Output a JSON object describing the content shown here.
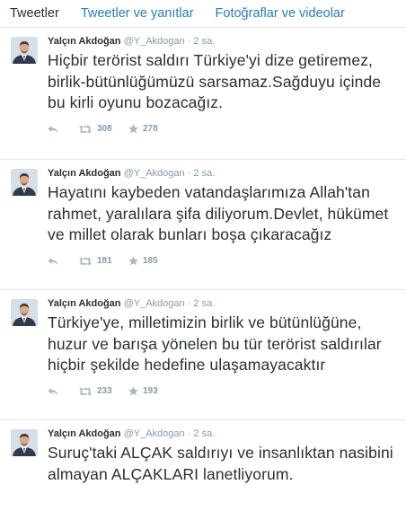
{
  "tabs": [
    {
      "label": "Tweetler"
    },
    {
      "label": "Tweetler ve yanıtlar"
    },
    {
      "label": "Fotoğraflar ve videolar"
    }
  ],
  "tweets": [
    {
      "name": "Yalçın Akdoğan",
      "handle": "@Y_Akdogan",
      "separator": "·",
      "time": "2 sa.",
      "text": "Hiçbir terörist saldırı Türkiye'yi dize getiremez, birlik-bütünlüğümüzü sarsamaz.Sağduyu içinde bu kirli oyunu bozacağız.",
      "retweets": "308",
      "favorites": "278"
    },
    {
      "name": "Yalçın Akdoğan",
      "handle": "@Y_Akdogan",
      "separator": "·",
      "time": "2 sa.",
      "text": "Hayatını kaybeden vatandaşlarımıza Allah'tan rahmet, yaralılara şifa diliyorum.Devlet, hükümet ve millet olarak bunları boşa çıkaracağız",
      "retweets": "181",
      "favorites": "185"
    },
    {
      "name": "Yalçın Akdoğan",
      "handle": "@Y_Akdogan",
      "separator": "·",
      "time": "2 sa.",
      "text": "Türkiye'ye, milletimizin birlik ve bütünlüğüne, huzur ve barışa yönelen bu tür terörist saldırılar hiçbir şekilde hedefine ulaşamayacaktır",
      "retweets": "233",
      "favorites": "193"
    },
    {
      "name": "Yalçın Akdoğan",
      "handle": "@Y_Akdogan",
      "separator": "·",
      "time": "2 sa.",
      "text": "Suruç'taki ALÇAK saldırıyı ve insanlıktan nasibini almayan ALÇAKLARI lanetliyorum."
    }
  ],
  "colors": {
    "link": "#2b7bb9",
    "text": "#292f33",
    "muted": "#8899a6",
    "icon": "#aab8c2",
    "border": "#e1e8ed"
  },
  "icons": {
    "reply": "reply-icon",
    "retweet": "retweet-icon",
    "favorite": "star-icon"
  }
}
